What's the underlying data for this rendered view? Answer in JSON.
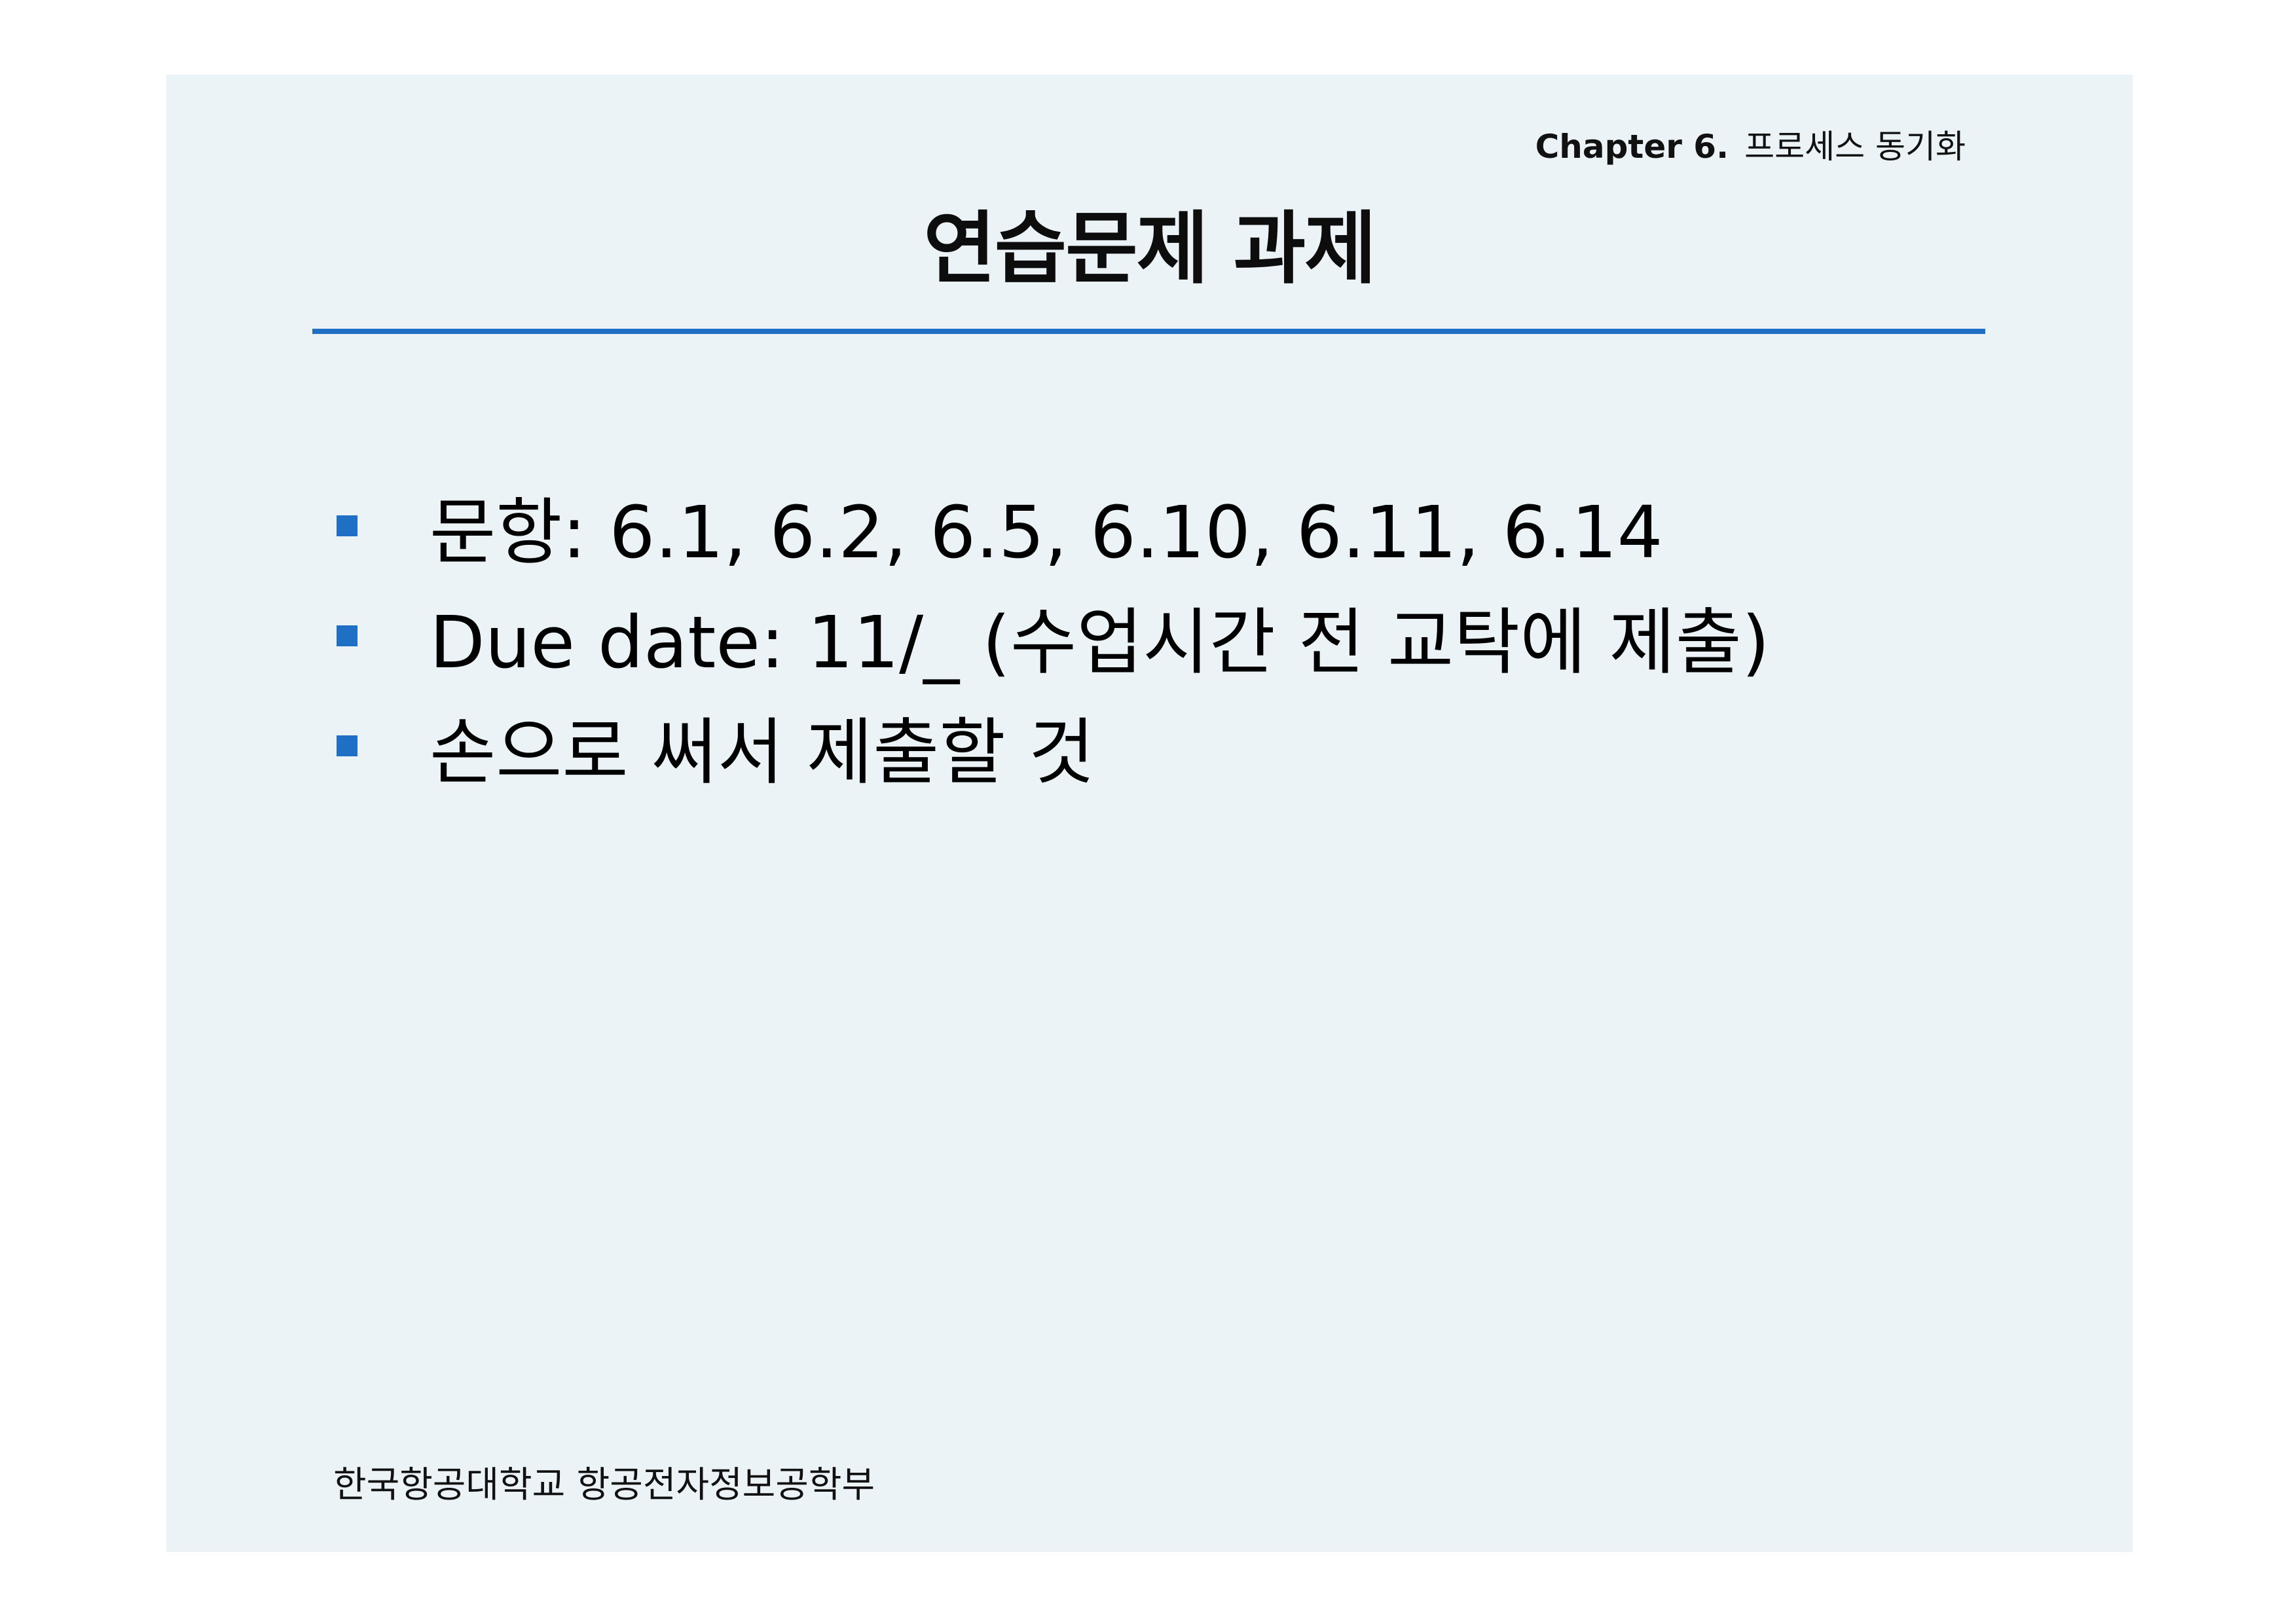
{
  "header": {
    "chapter_label": "Chapter 6.",
    "chapter_topic": "프로세스 동기화"
  },
  "title": "연습문제 과제",
  "bullets": [
    "문항:  6.1, 6.2, 6.5, 6.10, 6.11, 6.14",
    "Due date: 11/_ (수업시간 전 교탁에 제출)",
    "손으로 써서 제출할 것"
  ],
  "footer": "한국항공대학교 항공전자정보공학부",
  "colors": {
    "accent": "#1f6fc5",
    "slide_background": "#ebf3f7"
  }
}
